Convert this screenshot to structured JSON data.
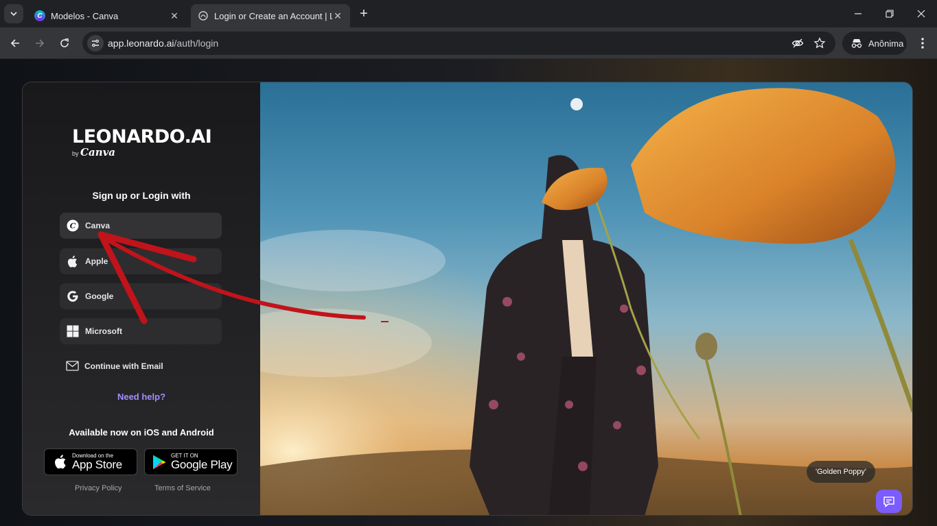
{
  "browser": {
    "tabs": [
      {
        "title": "Modelos - Canva",
        "active": false,
        "icon": "canva-favicon"
      },
      {
        "title": "Login or Create an Account | Leonardo.AI",
        "active": true,
        "icon": "leonardo-favicon"
      }
    ],
    "url_host": "app.leonardo.ai",
    "url_path": "/auth/login",
    "profile_label": "Anônima"
  },
  "login": {
    "logo_text": "LEONARDO.AI",
    "logo_by": "by",
    "logo_canva": "Canva",
    "heading": "Sign up or Login with",
    "providers": [
      {
        "label": "Canva",
        "icon": "canva-icon"
      },
      {
        "label": "Apple",
        "icon": "apple-icon"
      },
      {
        "label": "Google",
        "icon": "google-icon"
      },
      {
        "label": "Microsoft",
        "icon": "microsoft-icon"
      }
    ],
    "email_label": "Continue with Email",
    "need_help": "Need help?",
    "available": "Available now on iOS and Android",
    "app_store": {
      "small": "Download on the",
      "big": "App Store"
    },
    "google_play": {
      "small": "GET IT ON",
      "big": "Google Play"
    },
    "privacy": "Privacy Policy",
    "terms": "Terms of Service"
  },
  "hero": {
    "caption": "'Golden Poppy'"
  },
  "colors": {
    "accent": "#a48cff",
    "chat_button": "#7b5cff",
    "arrow": "#c0141a"
  }
}
